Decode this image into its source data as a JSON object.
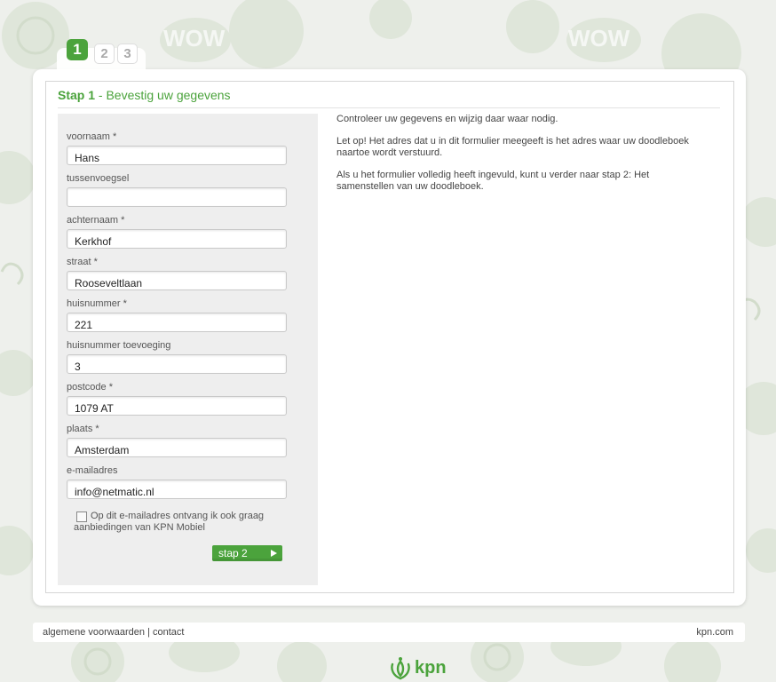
{
  "steps": {
    "active": "1",
    "step2": "2",
    "step3": "3"
  },
  "header": {
    "step_label": "Stap 1",
    "title": " - Bevestig uw gegevens"
  },
  "form": {
    "fields": [
      {
        "label": "voornaam *",
        "value": "Hans"
      },
      {
        "label": "tussenvoegsel",
        "value": ""
      },
      {
        "label": "achternaam *",
        "value": "Kerkhof"
      },
      {
        "label": "straat *",
        "value": "Rooseveltlaan"
      },
      {
        "label": "huisnummer *",
        "value": "221"
      },
      {
        "label": "huisnummer toevoeging",
        "value": "3"
      },
      {
        "label": "postcode *",
        "value": "1079 AT"
      },
      {
        "label": "plaats *",
        "value": "Amsterdam"
      },
      {
        "label": "e-mailadres",
        "value": "info@netmatic.nl"
      }
    ],
    "optin_label": "Op dit e-mailadres ontvang ik ook graag aanbiedingen van KPN Mobiel",
    "optin_checked": false,
    "next_button": "stap 2"
  },
  "info": {
    "p1": "Controleer uw gegevens en wijzig daar waar nodig.",
    "p2": "Let op! Het adres dat u in dit formulier meegeeft is het adres waar uw doodleboek naartoe wordt verstuurd.",
    "p3": "Als u het formulier volledig heeft ingevuld, kunt u verder naar stap 2: Het samenstellen van uw doodleboek."
  },
  "footer": {
    "terms": "algemene voorwaarden",
    "separator": " | ",
    "contact": "contact",
    "site": "kpn.com"
  },
  "logo": {
    "text": "kpn"
  },
  "colors": {
    "accent": "#4ba33c",
    "background": "#eef0ec"
  }
}
